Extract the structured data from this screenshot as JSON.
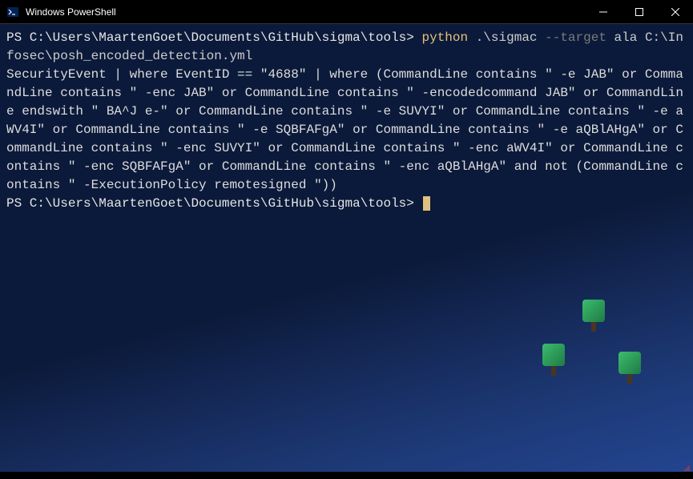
{
  "window": {
    "title": "Windows PowerShell"
  },
  "terminal": {
    "prompt1": "PS C:\\Users\\MaartenGoet\\Documents\\GitHub\\sigma\\tools> ",
    "command_part1": "python ",
    "command_part2": ".\\sigmac ",
    "command_flag": "--target ",
    "command_args": "ala C:\\Infosec\\posh_encoded_detection.yml",
    "output": "SecurityEvent | where EventID == \"4688\" | where (CommandLine contains \" -e JAB\" or CommandLine contains \" -enc JAB\" or CommandLine contains \" -encodedcommand JAB\" or CommandLine endswith \" BA^J e-\" or CommandLine contains \" -e SUVYI\" or CommandLine contains \" -e aWV4I\" or CommandLine contains \" -e SQBFAFgA\" or CommandLine contains \" -e aQBlAHgA\" or CommandLine contains \" -enc SUVYI\" or CommandLine contains \" -enc aWV4I\" or CommandLine contains \" -enc SQBFAFgA\" or CommandLine contains \" -enc aQBlAHgA\" and not (CommandLine contains \" -ExecutionPolicy remotesigned \"))",
    "prompt2": "PS C:\\Users\\MaartenGoet\\Documents\\GitHub\\sigma\\tools> "
  }
}
